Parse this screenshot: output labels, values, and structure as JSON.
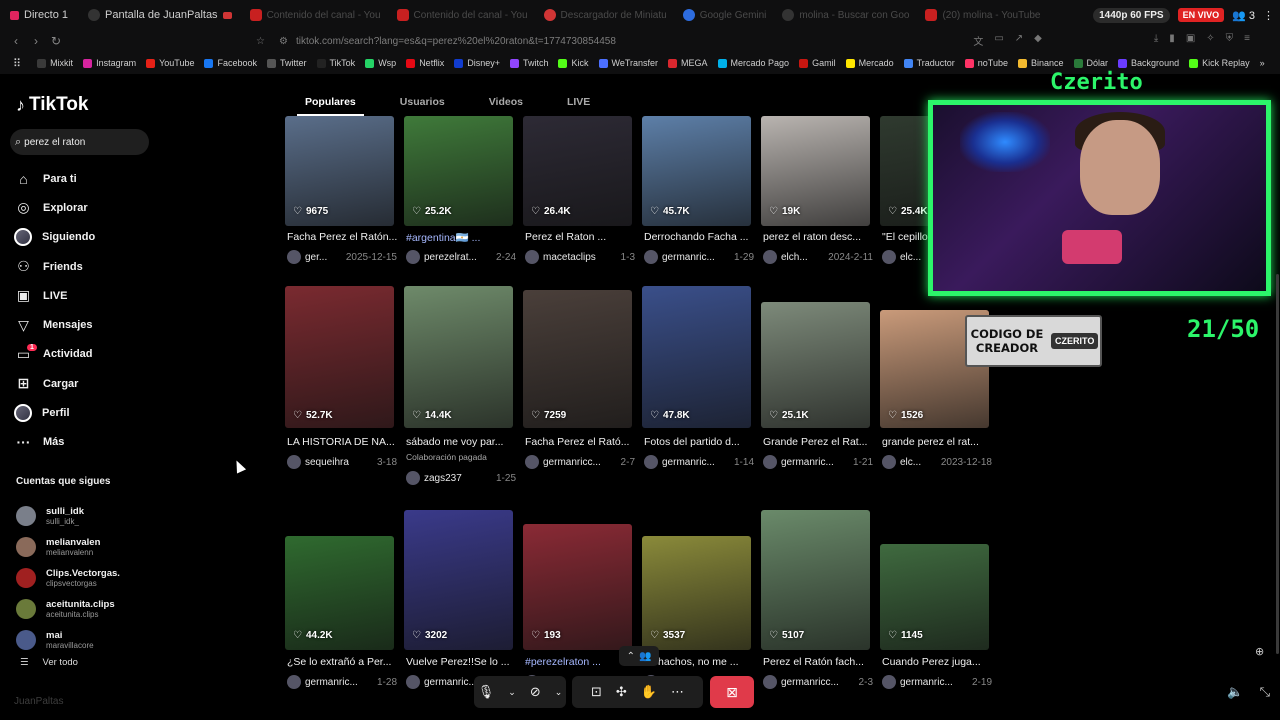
{
  "browser": {
    "tabs": [
      {
        "label": "Directo 1",
        "icon": "live-icon"
      },
      {
        "label": "Pantalla de JuanPaltas",
        "icon": "avatar-icon"
      },
      {
        "label": "Contenido del canal - You",
        "icon": "youtube-icon"
      },
      {
        "label": "Contenido del canal - You",
        "icon": "youtube-icon"
      },
      {
        "label": "Descargador de Miniatu",
        "icon": "download-icon"
      },
      {
        "label": "Google Gemini",
        "icon": "gemini-icon"
      },
      {
        "label": "molina - Buscar con Goo",
        "icon": "google-icon"
      },
      {
        "label": "(20) molina - YouTube",
        "icon": "youtube-icon"
      }
    ],
    "stream_quality": "1440p 60 FPS",
    "live_label": "EN VIVO",
    "viewers": "3",
    "url": "tiktok.com/search?lang=es&q=perez%20el%20raton&t=1774730854458",
    "bookmarks": [
      "Mixkit",
      "Instagram",
      "YouTube",
      "Facebook",
      "Twitter",
      "TikTok",
      "Wsp",
      "Netflix",
      "Disney+",
      "Twitch",
      "Kick",
      "WeTransfer",
      "MEGA",
      "Mercado Pago",
      "Gamil",
      "Mercado",
      "Traductor",
      "noTube",
      "Binance",
      "Dólar",
      "Background",
      "Kick Replay"
    ]
  },
  "sidebar": {
    "brand": "TikTok",
    "search_value": "perez el raton",
    "nav": [
      {
        "label": "Para ti",
        "icon": "home-icon"
      },
      {
        "label": "Explorar",
        "icon": "compass-icon"
      },
      {
        "label": "Siguiendo",
        "icon": "following-avatar-icon"
      },
      {
        "label": "Friends",
        "icon": "friends-icon"
      },
      {
        "label": "LIVE",
        "icon": "live-tv-icon"
      },
      {
        "label": "Mensajes",
        "icon": "send-icon"
      },
      {
        "label": "Actividad",
        "icon": "activity-icon",
        "badge": "1"
      },
      {
        "label": "Cargar",
        "icon": "upload-icon"
      },
      {
        "label": "Perfil",
        "icon": "profile-avatar-icon"
      },
      {
        "label": "Más",
        "icon": "more-icon"
      }
    ],
    "following_title": "Cuentas que sigues",
    "following": [
      {
        "name": "sulli_idk",
        "handle": "sulli_idk_"
      },
      {
        "name": "melianvalen",
        "handle": "melianvalenn"
      },
      {
        "name": "Clips.Vectorgas.",
        "handle": "clipsvectorgas"
      },
      {
        "name": "aceitunita.clips",
        "handle": "aceitunita.clips"
      },
      {
        "name": "mai",
        "handle": "maravillacore"
      }
    ],
    "see_all": "Ver todo",
    "sharer": "JuanPaltas"
  },
  "search_tabs": [
    {
      "label": "Populares",
      "active": true
    },
    {
      "label": "Usuarios",
      "active": false
    },
    {
      "label": "Videos",
      "active": false
    },
    {
      "label": "LIVE",
      "active": false
    }
  ],
  "results": [
    {
      "likes": "9675",
      "caption": "Facha Perez el Ratón...",
      "user": "ger...",
      "date": "2025-12-15",
      "color": "#5a6e8a"
    },
    {
      "likes": "25.2K",
      "caption": "#argentina🇦🇷 ...",
      "tag": true,
      "user": "perezelrat...",
      "date": "2-24",
      "color": "#3f7a3a"
    },
    {
      "likes": "26.4K",
      "caption": "Perez el Raton ...",
      "user": "macetaclips",
      "date": "1-3",
      "color": "#2d2a35"
    },
    {
      "likes": "45.7K",
      "caption": "Derrochando Facha ...",
      "user": "germanric...",
      "date": "1-29",
      "color": "#5d7fa8"
    },
    {
      "likes": "19K",
      "caption": "perez el raton desc...",
      "user": "elch...",
      "date": "2024-2-11",
      "color": "#b9b4b0"
    },
    {
      "likes": "25.4K",
      "caption": "\"El cepillo\"...",
      "user": "elc...",
      "date": "",
      "color": "#2f3a2f"
    },
    {
      "likes": "52.7K",
      "caption": "LA HISTORIA DE NA...",
      "user": "sequeihra",
      "date": "3-18",
      "color": "#7a2a30"
    },
    {
      "likes": "14.4K",
      "caption": "sábado me voy par...",
      "collab": "Colaboración pagada",
      "user": "zags237",
      "date": "1-25",
      "color": "#6e8a6a"
    },
    {
      "likes": "7259",
      "caption": "Facha Perez el Rató...",
      "user": "germanricc...",
      "date": "2-7",
      "color": "#4a3f3a"
    },
    {
      "likes": "47.8K",
      "caption": "Fotos del partido d...",
      "user": "germanric...",
      "date": "1-14",
      "color": "#3a4f8a"
    },
    {
      "likes": "25.1K",
      "caption": "Grande Perez el Rat...",
      "user": "germanric...",
      "date": "1-21",
      "color": "#7d8a7a"
    },
    {
      "likes": "1526",
      "caption": "grande perez el rat...",
      "user": "elc...",
      "date": "2023-12-18",
      "color": "#c99a7a"
    },
    {
      "likes": "44.2K",
      "caption": "¿Se lo extrañó a Per...",
      "user": "germanric...",
      "date": "1-28",
      "color": "#2f6a2f"
    },
    {
      "likes": "3202",
      "caption": "Vuelve Perez!!Se lo ...",
      "user": "germanric...",
      "date": "",
      "color": "#3a3a8a"
    },
    {
      "likes": "193",
      "caption": "#perezelraton ...",
      "tag": true,
      "user": "",
      "date": "",
      "color": "#8a2a35"
    },
    {
      "likes": "3537",
      "caption": "...chachos, no me ...",
      "user": "",
      "date": "",
      "color": "#8a8a3a"
    },
    {
      "likes": "5107",
      "caption": "Perez el Ratón fach...",
      "user": "germanricc...",
      "date": "2-3",
      "color": "#6a8a6a"
    },
    {
      "likes": "1145",
      "caption": "Cuando Perez juga...",
      "user": "germanric...",
      "date": "2-19",
      "color": "#3f6a3f"
    }
  ],
  "overlay": {
    "streamer_name": "Czerito",
    "creator_code_text": "CODIGO DE CREADOR",
    "creator_code_tag": "CZERITO",
    "counter": "21/50"
  }
}
